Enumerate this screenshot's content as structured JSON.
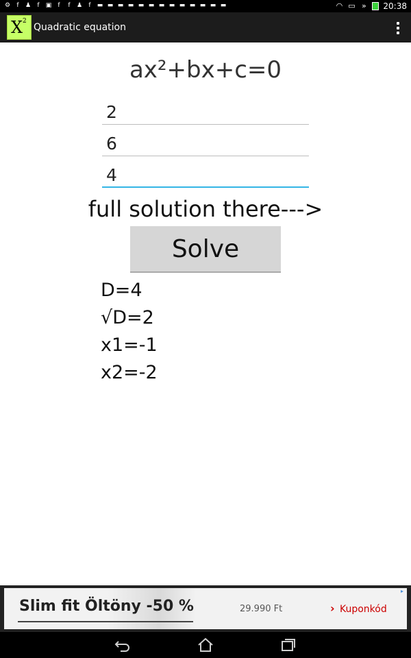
{
  "status_bar": {
    "time": "20:38",
    "notification_icons": [
      "settings-icon",
      "facebook-icon",
      "person-add-icon",
      "facebook-icon",
      "image-icon",
      "facebook-icon",
      "facebook-icon",
      "person-add-icon",
      "facebook-icon",
      "chat-icon",
      "chat-icon",
      "chat-icon",
      "chat-icon",
      "chat-icon",
      "chat-icon",
      "chat-icon",
      "chat-icon",
      "chat-icon",
      "chat-icon",
      "chat-icon",
      "chat-icon",
      "chat-icon"
    ],
    "system_icons": [
      "wifi-icon",
      "download-icon",
      "battery-charging-icon"
    ]
  },
  "action_bar": {
    "app_icon": {
      "base": "X",
      "superscript": "2"
    },
    "title": "Quadratic equation",
    "overflow_icon": "more-vert-icon"
  },
  "main": {
    "formula": "ax²+bx+c=0",
    "coefficients": {
      "a": "2",
      "b": "6",
      "c": "4"
    },
    "hint": "full solution there--->",
    "solve_label": "Solve",
    "results": {
      "discriminant": "D=4",
      "sqrt_discriminant": "√D=2",
      "x1": "x1=-1",
      "x2": "x2=-2"
    }
  },
  "ad": {
    "title": "Slim fit Öltöny -50 %",
    "price": "29.990 Ft",
    "cta": "Kuponkód",
    "colors": {
      "cta": "#cc0000"
    }
  },
  "nav_bar": {
    "icons": [
      "back-icon",
      "home-icon",
      "recent-apps-icon"
    ]
  },
  "colors": {
    "action_bar": "#1c1c1c",
    "app_icon_bg": "#c6ff66",
    "focus_underline": "#33b5e5",
    "button_bg": "#d6d6d6"
  }
}
